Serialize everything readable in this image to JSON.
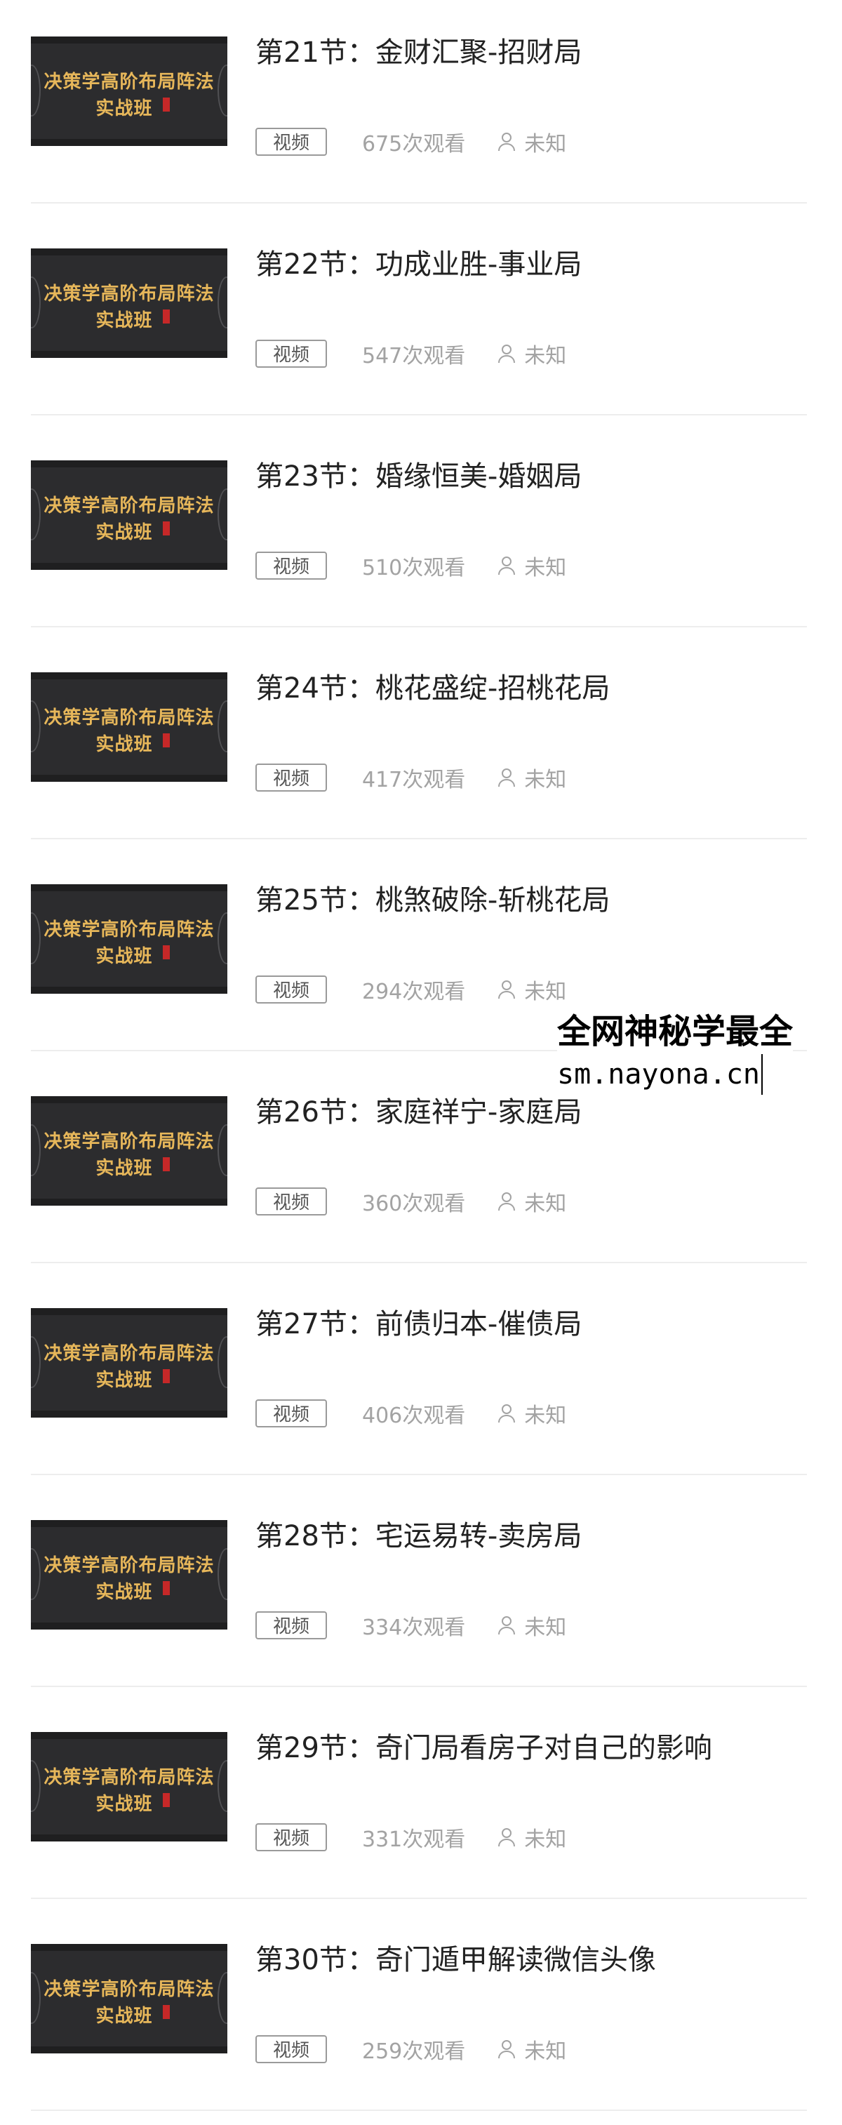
{
  "lessons": [
    {
      "title": "第21节：金财汇聚-招财局",
      "type": "视频",
      "views": "675次观看",
      "author": "未知"
    },
    {
      "title": "第22节：功成业胜-事业局",
      "type": "视频",
      "views": "547次观看",
      "author": "未知"
    },
    {
      "title": "第23节：婚缘恒美-婚姻局",
      "type": "视频",
      "views": "510次观看",
      "author": "未知"
    },
    {
      "title": "第24节：桃花盛绽-招桃花局",
      "type": "视频",
      "views": "417次观看",
      "author": "未知"
    },
    {
      "title": "第25节：桃煞破除-斩桃花局",
      "type": "视频",
      "views": "294次观看",
      "author": "未知"
    },
    {
      "title": "第26节：家庭祥宁-家庭局",
      "type": "视频",
      "views": "360次观看",
      "author": "未知"
    },
    {
      "title": "第27节：前债归本-催债局",
      "type": "视频",
      "views": "406次观看",
      "author": "未知"
    },
    {
      "title": "第28节：宅运易转-卖房局",
      "type": "视频",
      "views": "334次观看",
      "author": "未知"
    },
    {
      "title": "第29节：奇门局看房子对自己的影响",
      "type": "视频",
      "views": "331次观看",
      "author": "未知"
    },
    {
      "title": "第30节：奇门遁甲解读微信头像",
      "type": "视频",
      "views": "259次观看",
      "author": "未知"
    }
  ],
  "thumbnail": {
    "line1": "决策学高阶布局阵法",
    "line2": "实战班"
  },
  "watermark": {
    "line1": "全网神秘学最全",
    "line2": "sm.nayona.cn"
  },
  "colors": {
    "thumb_bg": "#2c2c2e",
    "thumb_text": "#e7b75a",
    "meta_text": "#a3a3a3"
  },
  "icons": {
    "author": "person-icon"
  }
}
